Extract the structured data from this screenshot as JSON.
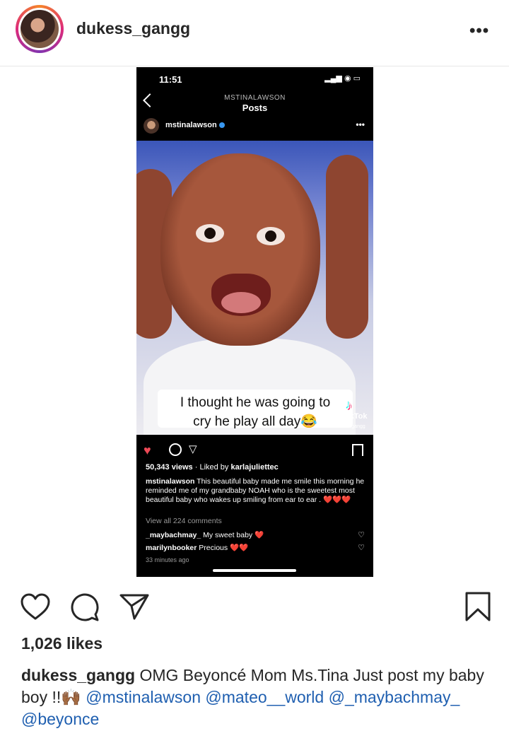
{
  "header": {
    "username": "dukess_gangg",
    "more_icon": "more-options-icon",
    "more_label": "•••"
  },
  "inner_post": {
    "status_time": "11:51",
    "status_icons": "▂▄▆ ◉ ▭",
    "subtitle": "MSTINALAWSON",
    "title": "Posts",
    "username": "mstinalawson",
    "more_label": "•••",
    "video_caption_line1": "I thought he was going to",
    "video_caption_line2": "cry he play all day😂",
    "tiktok_label": "TikTok",
    "tiktok_user": "dukessgangg",
    "views": "50,343 views",
    "liked_by_prefix": "· Liked by",
    "liked_by_user": "karlajuliettec",
    "caption_user": "mstinalawson",
    "caption_text": "This beautiful baby made me smile this morning he reminded me of my grandbaby  NOAH who is the sweetest most beautiful baby who wakes up smiling from ear to ear . ❤️❤️❤️",
    "view_all_comments": "View all 224 comments",
    "comments": [
      {
        "user": "_maybachmay_",
        "text": "My sweet baby ❤️"
      },
      {
        "user": "marilynbooker",
        "text": "Precious ❤️❤️"
      }
    ],
    "time_ago": "33 minutes ago"
  },
  "actions": {
    "like_icon": "heart-icon",
    "comment_icon": "comment-icon",
    "share_icon": "paper-plane-icon",
    "save_icon": "bookmark-icon"
  },
  "likes": "1,026 likes",
  "caption": {
    "username": "dukess_gangg",
    "text": "OMG Beyoncé Mom Ms.Tina Just post my baby boy !!🙌🏾",
    "mentions": [
      "@mstinalawson",
      "@mateo__world",
      "@_maybachmay_",
      "@beyonce"
    ]
  },
  "colors": {
    "mention": "#1f5fb0",
    "like_red": "#ed4956",
    "text": "#262626"
  }
}
